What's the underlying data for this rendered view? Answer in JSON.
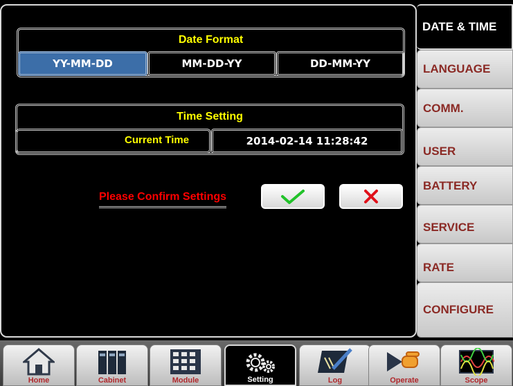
{
  "date_format": {
    "title": "Date Format",
    "options": [
      "YY-MM-DD",
      "MM-DD-YY",
      "DD-MM-YY"
    ],
    "selected": "YY-MM-DD"
  },
  "time_setting": {
    "title": "Time Setting",
    "current_time_label": "Current Time",
    "current_time_value": "2014-02-14  11:28:42"
  },
  "confirm": {
    "prompt": "Please Confirm Settings"
  },
  "tabs": [
    "DATE & TIME",
    "LANGUAGE",
    "COMM.",
    "USER",
    "BATTERY",
    "SERVICE",
    "RATE",
    "CONFIGURE"
  ],
  "active_tab": "DATE & TIME",
  "nav": [
    "Home",
    "Cabinet",
    "Module",
    "Setting",
    "Log",
    "Operate",
    "Scope"
  ],
  "active_nav": "Setting",
  "colors": {
    "selected": "#3c6ea8",
    "label_yellow": "#ffff00",
    "warning_red": "#ff0000",
    "tab_text": "#8b2a25",
    "confirm_green": "#22c22a",
    "cancel_red": "#e0101a"
  }
}
